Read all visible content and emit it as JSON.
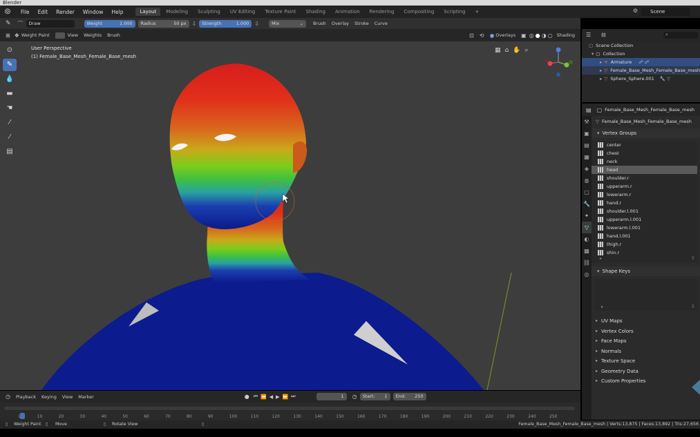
{
  "window": {
    "title": "Blender"
  },
  "menubar": {
    "logo_icon": "blender-logo-icon",
    "menus": [
      "File",
      "Edit",
      "Render",
      "Window",
      "Help"
    ],
    "workspaces": [
      "Layout",
      "Modeling",
      "Sculpting",
      "UV Editing",
      "Texture Paint",
      "Shading",
      "Animation",
      "Rendering",
      "Compositing",
      "Scripting"
    ],
    "add_tab": "+",
    "scene": "Scene"
  },
  "tool_settings": {
    "brush": "Draw",
    "weight_label": "Weight",
    "weight_value": "1.000",
    "radius_label": "Radius",
    "radius_value": "50 px",
    "strength_label": "Strength",
    "strength_value": "1.000",
    "blend": "Mix",
    "brush_menu": "Brush",
    "overlay_menu": "Overlay",
    "stroke_menu": "Stroke",
    "curve_menu": "Curve"
  },
  "viewport_header": {
    "mode": "Weight Paint",
    "menus": [
      "View",
      "Weights",
      "Brush"
    ],
    "overlays": "Overlays",
    "shading": "Shading"
  },
  "viewport": {
    "perspective": "User Perspective",
    "object": "(1) Female_Base_Mesh_Female_Base_mesh"
  },
  "outliner": {
    "root": "Scene Collection",
    "collection": "Collection",
    "items": [
      "Armature",
      "Female_Base_Mesh_Female_Base_mesh",
      "Sphere_Sphere.001"
    ]
  },
  "properties": {
    "object_name": "Female_Base_Mesh_Female_Base_mesh",
    "data_name": "Female_Base_Mesh_Female_Base_mesh",
    "vertex_groups_title": "Vertex Groups",
    "vertex_groups": [
      "center",
      "chest",
      "neck",
      "head",
      "shoulder.r",
      "upperarm.r",
      "lowerarm.r",
      "hand.r",
      "shoulder.l.001",
      "upperarm.l.001",
      "lowerarm.l.001",
      "hand.l.001",
      "thigh.r",
      "shin.r"
    ],
    "selected_group": "head",
    "shape_keys_title": "Shape Keys",
    "collapsed_panels": [
      "UV Maps",
      "Vertex Colors",
      "Face Maps",
      "Normals",
      "Texture Space",
      "Geometry Data",
      "Custom Properties"
    ]
  },
  "timeline": {
    "menus": [
      "Playback",
      "Keying",
      "View",
      "Marker"
    ],
    "current_frame": "1",
    "start_label": "Start:",
    "start_value": "1",
    "end_label": "End:",
    "end_value": "250",
    "ticks": [
      "1",
      "10",
      "20",
      "30",
      "40",
      "50",
      "60",
      "70",
      "80",
      "90",
      "100",
      "110",
      "120",
      "130",
      "140",
      "150",
      "160",
      "170",
      "180",
      "190",
      "200",
      "210",
      "220",
      "230",
      "240",
      "250"
    ]
  },
  "statusbar": {
    "left1": "Weight Paint",
    "left2": "Move",
    "left3": "Rotate View",
    "right": "Female_Base_Mesh_Female_Base_mesh | Verts:13,875 | Faces:13,892 | Tris:27,656"
  }
}
